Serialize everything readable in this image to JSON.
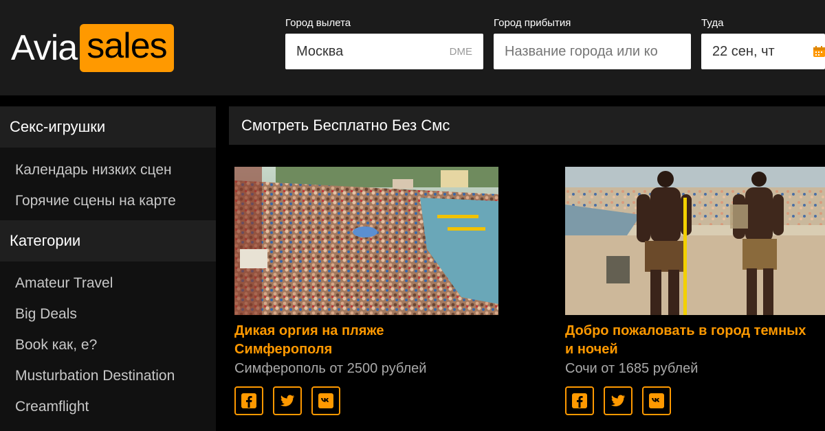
{
  "logo": {
    "avia": "Avia",
    "sales": "sales"
  },
  "search": {
    "from_label": "Город вылета",
    "from_value": "Москва",
    "from_code": "DME",
    "to_label": "Город прибытия",
    "to_placeholder": "Название города или ко",
    "date_label": "Туда",
    "date_value": "22 сен, чт"
  },
  "sidebar": {
    "section1_title": "Секс-игрушки",
    "section1_items": [
      "Календарь низких сцен",
      "Горячие сцены на карте"
    ],
    "section2_title": "Категории",
    "section2_items": [
      "Amateur Travel",
      "Big Deals",
      "Book как, е?",
      "Musturbation Destination",
      "Creamflight"
    ]
  },
  "main": {
    "header": "Смотреть Бесплатно Без Смс",
    "cards": [
      {
        "title_line1": "Дикая оргия на пляже",
        "title_line2": "Симферополя",
        "price": "Симферополь от 2500 рублей"
      },
      {
        "title_line1": "Добро пожаловать в город темных",
        "title_line2": "и ночей",
        "price": "Сочи от 1685 рублей"
      }
    ]
  },
  "colors": {
    "accent": "#ff9900",
    "header_bg": "#1b1b1b",
    "panel_bg": "#1f1f1f"
  },
  "icons": [
    "calendar-icon",
    "facebook-icon",
    "twitter-icon",
    "vk-icon"
  ]
}
